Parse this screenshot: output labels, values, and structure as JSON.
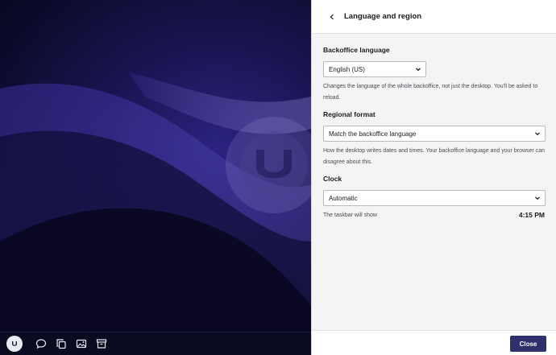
{
  "panel": {
    "title": "Language and region",
    "backoffice_language": {
      "heading": "Backoffice language",
      "selected": "English (US)",
      "help": "Changes the language of the whole backoffice, not just the desktop. You'll be asked to reload."
    },
    "regional_format": {
      "heading": "Regional format",
      "selected": "Match the backoffice language",
      "help": "How the desktop writes dates and times. Your backoffice language and your browser can disagree about this."
    },
    "clock": {
      "heading": "Clock",
      "selected": "Automatic",
      "preview_label": "The taskbar will show",
      "preview_time": "4:15 PM"
    },
    "close_label": "Close"
  },
  "taskbar": {
    "icons": [
      "umbraco-logo-icon",
      "chat-bubble-icon",
      "copy-icon",
      "image-icon",
      "archive-icon"
    ]
  },
  "colors": {
    "primary_button": "#30306d",
    "desktop_accent": "#2b2380"
  }
}
